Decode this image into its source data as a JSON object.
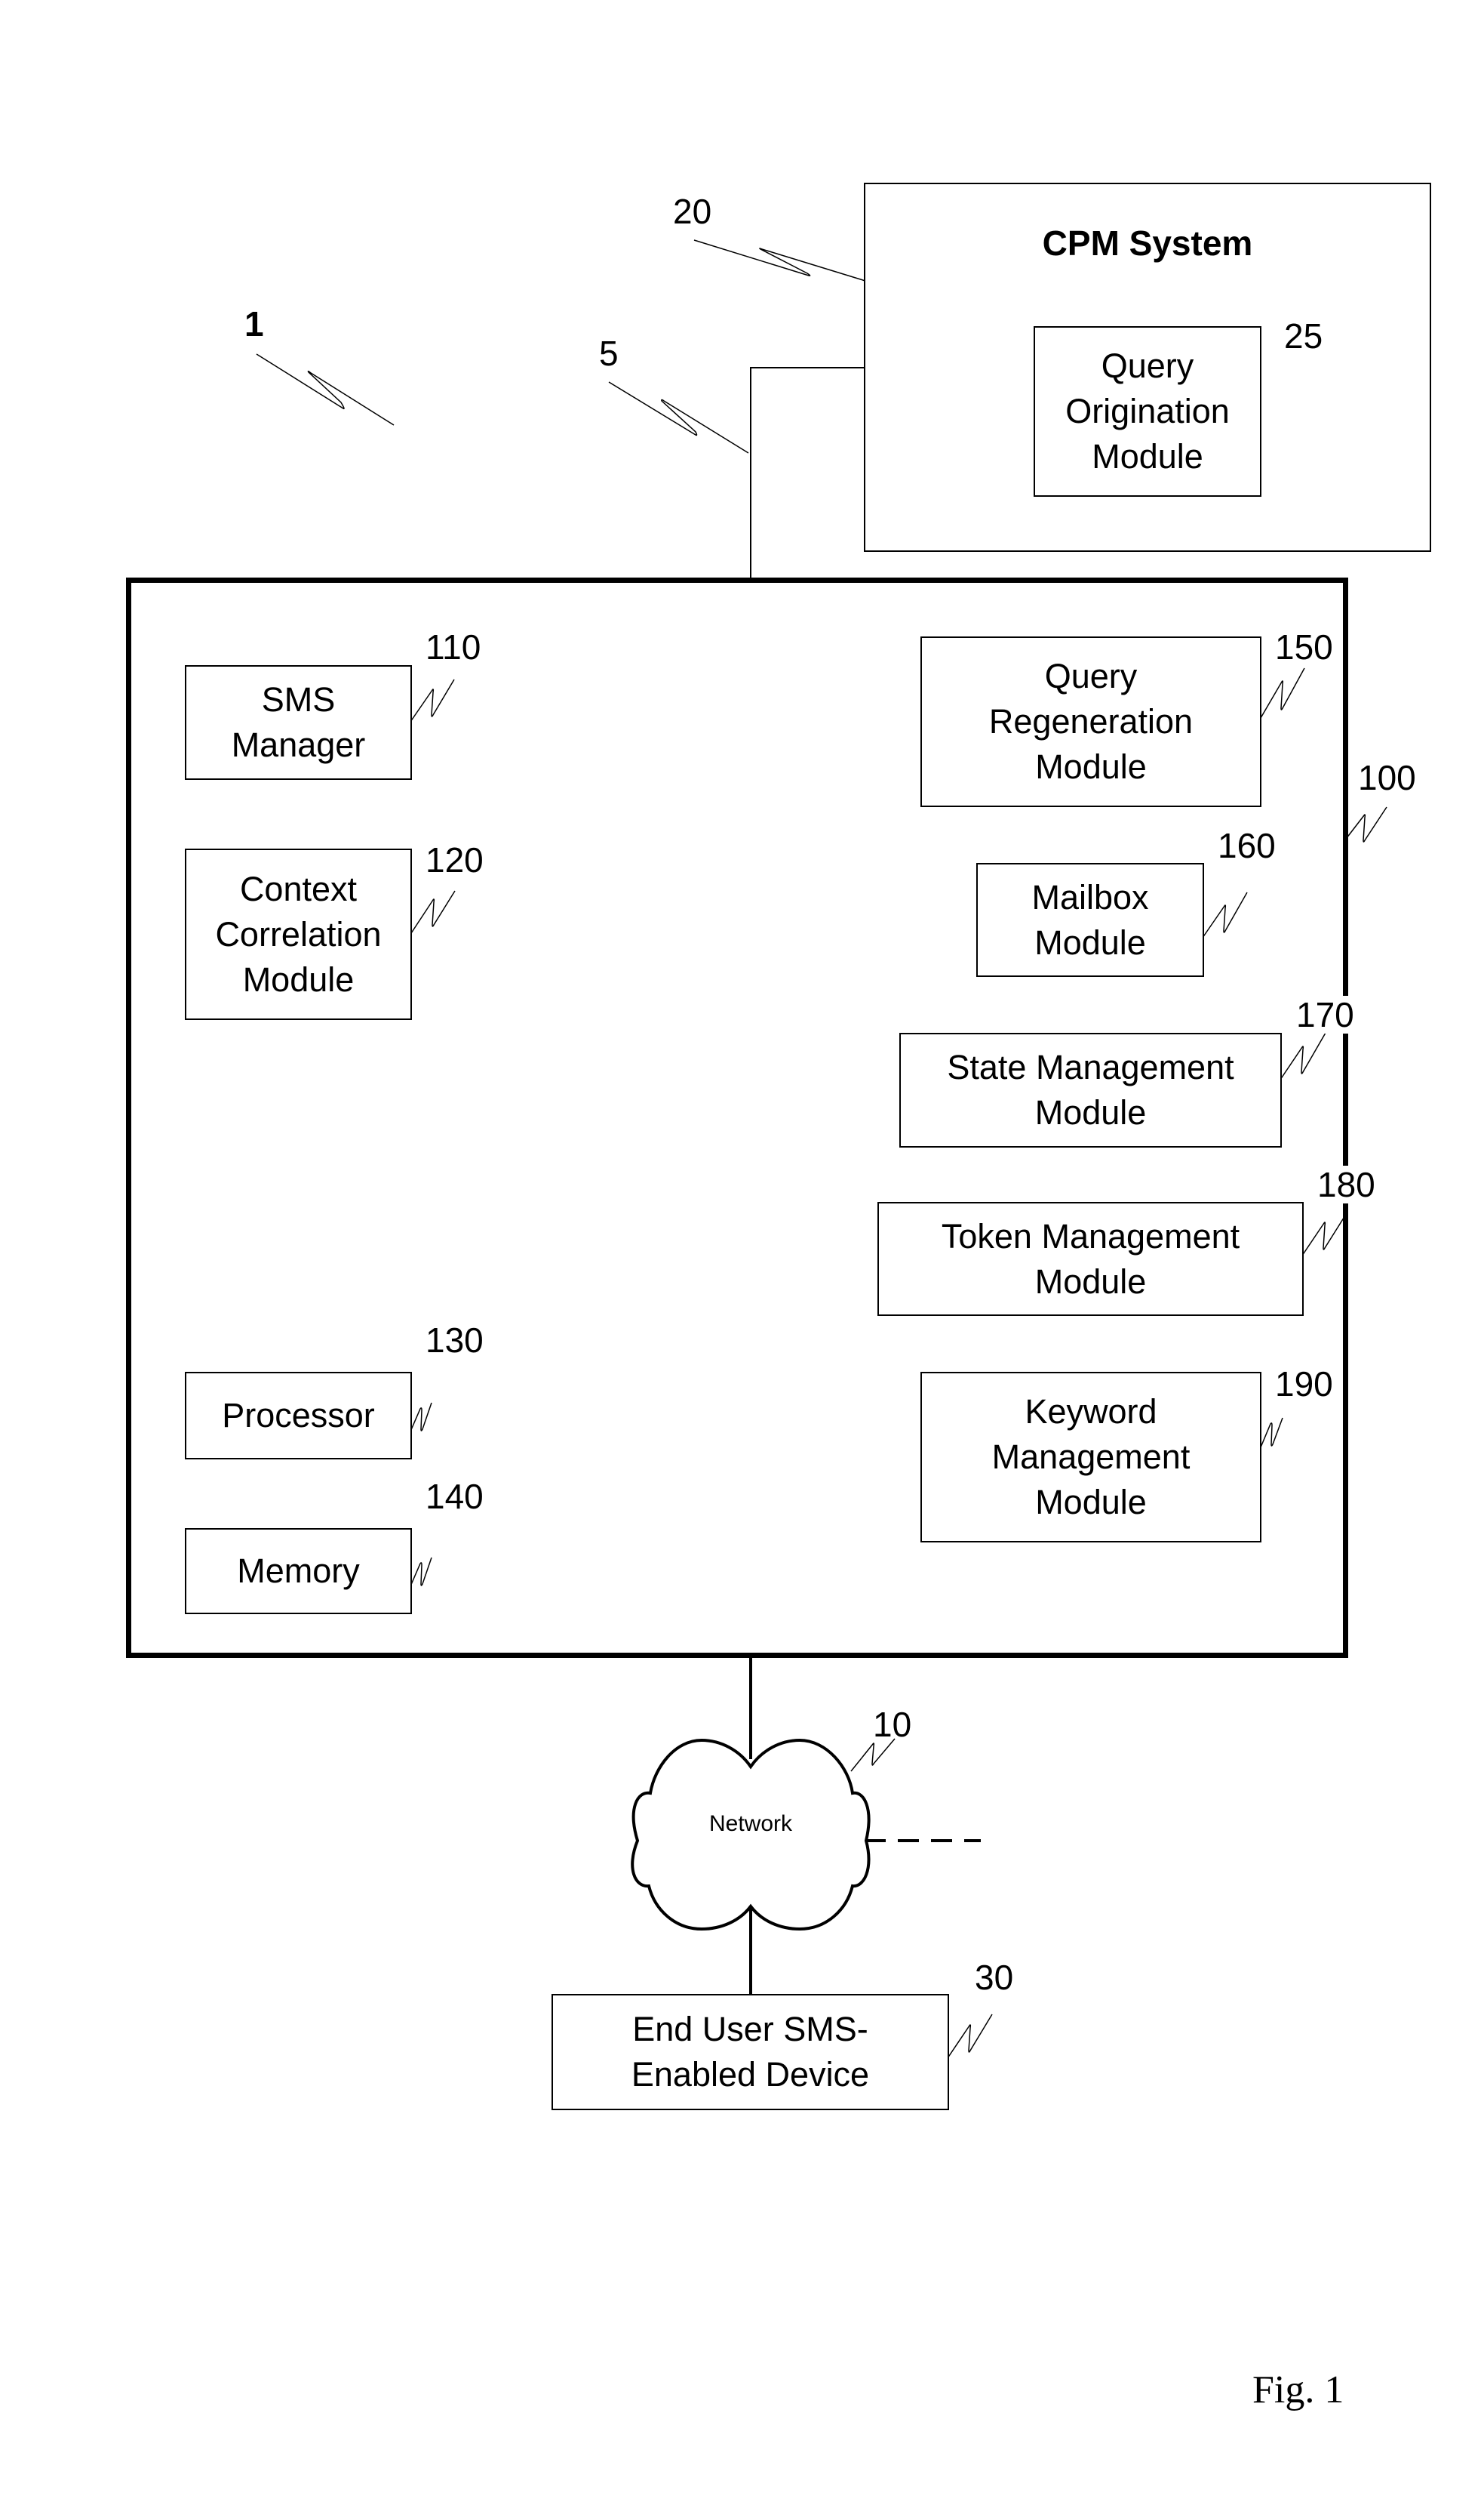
{
  "figure": {
    "caption": "Fig. 1",
    "system_ref": "1"
  },
  "cpm_system": {
    "title": "CPM System",
    "ref": "20",
    "link_ref": "5",
    "modules": [
      {
        "label": "Query\nOrigination\nModule",
        "ref": "25"
      }
    ]
  },
  "platform": {
    "ref": "100",
    "left_modules": [
      {
        "label": "SMS\nManager",
        "ref": "110"
      },
      {
        "label": "Context\nCorrelation\nModule",
        "ref": "120"
      },
      {
        "label": "Processor",
        "ref": "130"
      },
      {
        "label": "Memory",
        "ref": "140"
      }
    ],
    "right_modules": [
      {
        "label": "Query\nRegeneration\nModule",
        "ref": "150"
      },
      {
        "label": "Mailbox\nModule",
        "ref": "160"
      },
      {
        "label": "State Management\nModule",
        "ref": "170"
      },
      {
        "label": "Token Management\nModule",
        "ref": "180"
      },
      {
        "label": "Keyword\nManagement\nModule",
        "ref": "190"
      }
    ]
  },
  "network": {
    "label": "Network",
    "ref": "10"
  },
  "end_device": {
    "label": "End User SMS-\nEnabled Device",
    "ref": "30"
  }
}
